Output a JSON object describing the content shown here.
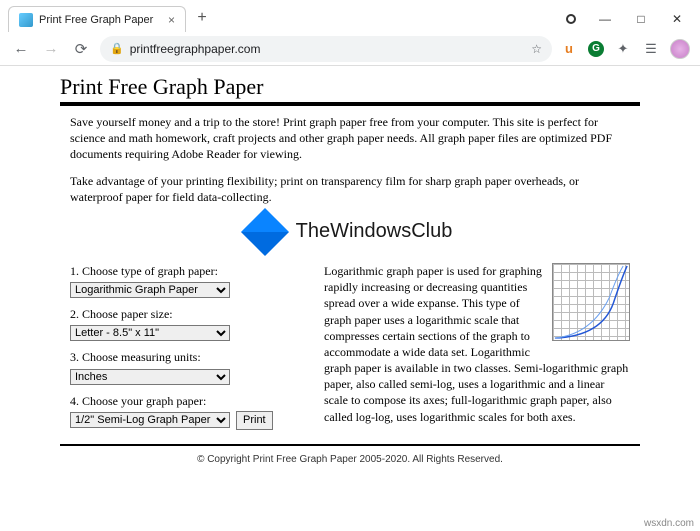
{
  "window": {
    "tab_title": "Print Free Graph Paper",
    "url_display": "printfreegraphpaper.com"
  },
  "ext": {
    "u": "u",
    "g": "G"
  },
  "page": {
    "heading": "Print Free Graph Paper",
    "intro1": "Save yourself money and a trip to the store! Print graph paper free from your computer. This site is perfect for science and math homework, craft projects and other graph paper needs. All graph paper files are optimized PDF documents requiring Adobe Reader for viewing.",
    "intro2": "Take advantage of your printing flexibility; print on transparency film for sharp graph paper overheads, or waterproof paper for field data-collecting.",
    "logo_text": "TheWindowsClub",
    "step1_label": "1. Choose type of graph paper:",
    "step1_value": "Logarithmic Graph Paper",
    "step2_label": "2. Choose paper size:",
    "step2_value": "Letter - 8.5\" x 11\"",
    "step3_label": "3. Choose measuring units:",
    "step3_value": "Inches",
    "step4_label": "4. Choose your graph paper:",
    "step4_value": "1/2\" Semi-Log Graph Paper",
    "print_btn": "Print",
    "desc": "Logarithmic graph paper is used for graphing rapidly increasing or decreasing quantities spread over a wide expanse. This type of graph paper uses a logarithmic scale that compresses certain sections of the graph to accommodate a wide data set. Logarithmic graph paper is available in two classes. Semi-logarithmic graph paper, also called semi-log, uses a logarithmic and a linear scale to compose its axes; full-logarithmic graph paper, also called log-log, uses logarithmic scales for both axes.",
    "copyright": "© Copyright Print Free Graph Paper 2005-2020. All Rights Reserved."
  },
  "watermark": "wsxdn.com"
}
